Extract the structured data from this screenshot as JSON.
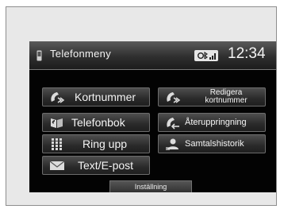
{
  "header": {
    "title": "Telefonmeny",
    "clock": "12:34",
    "phone_icon": "phone-icon",
    "status_icon": "bluetooth-signal-icon"
  },
  "menu": {
    "speed_dial": {
      "label": "Kortnummer",
      "icon": "speed-dial-icon"
    },
    "edit_speed_dial": {
      "label_line1": "Redigera",
      "label_line2": "kortnummer",
      "icon": "edit-speed-dial-icon"
    },
    "phonebook": {
      "label": "Telefonbok",
      "icon": "phonebook-icon"
    },
    "redial": {
      "label": "Återuppringning",
      "icon": "redial-icon"
    },
    "dial": {
      "label": "Ring upp",
      "icon": "keypad-icon"
    },
    "call_history": {
      "label": "Samtalshistorik",
      "icon": "call-history-icon"
    },
    "text_email": {
      "label": "Text/E-post",
      "icon": "envelope-icon"
    }
  },
  "footer": {
    "settings_label": "Inställning"
  },
  "colors": {
    "screen_bg": "#030303",
    "button_top": "#4e4e4e",
    "button_bottom": "#1f1f1f",
    "text": "#f4f4f4"
  }
}
